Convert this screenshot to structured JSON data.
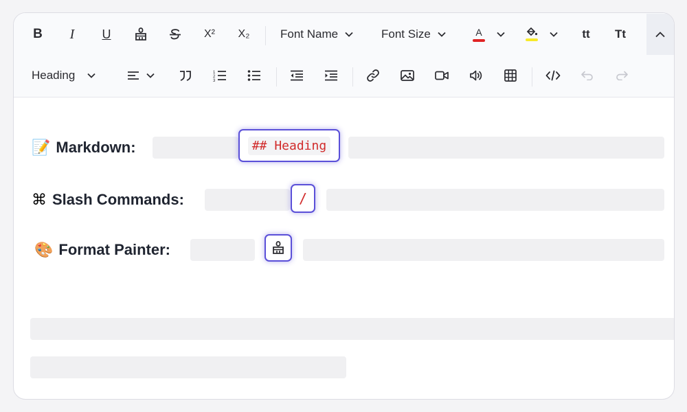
{
  "toolbar": {
    "font_name": "Font Name",
    "font_size": "Font Size",
    "heading": "Heading",
    "bold": "B",
    "italic": "I",
    "underline": "U",
    "superscript": "X²",
    "subscript": "X₂",
    "font_color_letter": "A",
    "lowercase": "tt",
    "capitalize": "Tt",
    "font_color": "#e02424",
    "highlight_color": "#f7ea2a"
  },
  "content": {
    "markdown": {
      "emoji": "📝",
      "label": "Markdown:",
      "code": "## Heading"
    },
    "slash": {
      "emoji": "⌘",
      "label": "Slash Commands:",
      "code": "/"
    },
    "painter": {
      "emoji": "🎨",
      "label": "Format Painter:"
    }
  },
  "colors": {
    "accent": "#5a4fd8",
    "code": "#d12b2b"
  }
}
